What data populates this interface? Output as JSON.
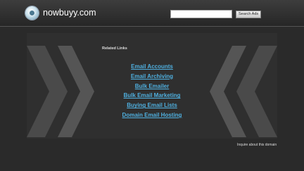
{
  "header": {
    "site_name": "nowbuyy.com",
    "search": {
      "value": "",
      "placeholder": "",
      "button_label": "Search Ads"
    }
  },
  "main": {
    "related_label": "Related Links",
    "links": [
      {
        "label": "Email Accounts"
      },
      {
        "label": "Email Archiving"
      },
      {
        "label": "Bulk Emailer"
      },
      {
        "label": "Bulk Email Marketing"
      },
      {
        "label": "Buying Email Lists"
      },
      {
        "label": "Domain Email Hosting"
      }
    ]
  },
  "footer": {
    "inquire_label": "Inquire about this domain"
  },
  "colors": {
    "link": "#4fb0e0",
    "background": "#2a2a2a",
    "panel": "#2f2f2f",
    "chevron": "#555555"
  },
  "icons": {
    "logo": "globe-logo-icon",
    "chevrons": "chevron-decoration-icon"
  }
}
